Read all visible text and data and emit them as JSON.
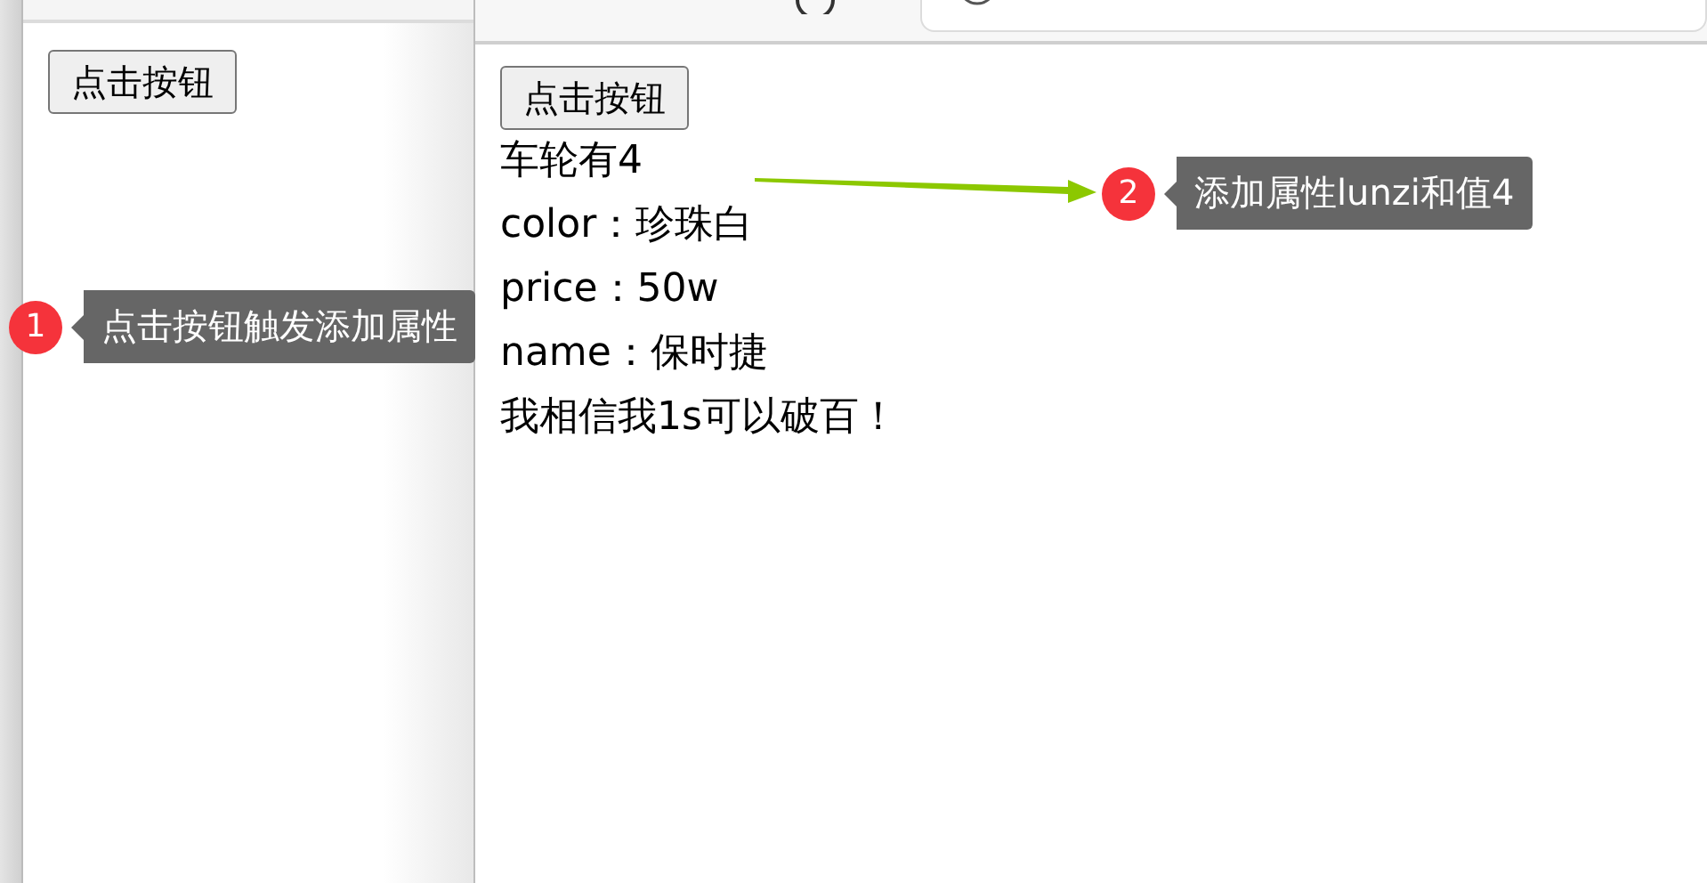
{
  "left_window": {
    "button": "点击按钮"
  },
  "right_window": {
    "button": "点击按钮",
    "lines": [
      "车轮有4",
      "color：珍珠白",
      "price：50w",
      "name：保时捷",
      "我相信我1s可以破百！"
    ]
  },
  "callouts": [
    {
      "number": "1",
      "text": "点击按钮触发添加属性"
    },
    {
      "number": "2",
      "text": "添加属性lunzi和值4"
    }
  ]
}
